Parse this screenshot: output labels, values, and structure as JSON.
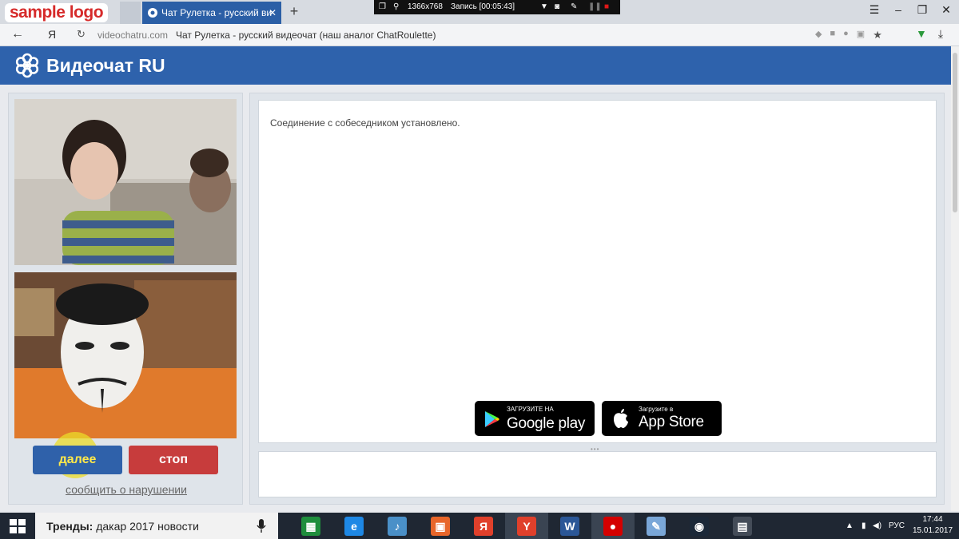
{
  "overlay_logo": "sample logo",
  "browser": {
    "tabs": [
      {
        "label": "",
        "active": false
      },
      {
        "label": "Чат Рулетка - русский ви",
        "active": true
      }
    ],
    "new_tab": "+",
    "recorder": {
      "resolution": "1366x768",
      "status": "Запись [00:05:43]"
    },
    "address": {
      "ya": "Я",
      "url": "videochatru.com",
      "title": "Чат Рулетка - русский видеочат (наш аналог ChatRoulette)"
    },
    "icons": [
      "back-arrow-icon",
      "reload-icon",
      "star-icon",
      "download-icon",
      "menu-icon"
    ]
  },
  "site": {
    "title": "Видеочат RU",
    "brand_color": "#2e62ac"
  },
  "controls": {
    "next_label": "далее",
    "stop_label": "стоп",
    "report_label": "сообщить о нарушении",
    "next_color": "#2f61aa",
    "stop_color": "#c73c3c"
  },
  "chat": {
    "status_message": "Соединение с собеседником установлено.",
    "google_play": {
      "small": "ЗАГРУЗИТЕ НА",
      "big": "Google play"
    },
    "app_store": {
      "small": "Загрузите в",
      "big": "App Store"
    }
  },
  "taskbar": {
    "search_prefix": "Тренды:",
    "search_text": "дакар 2017 новости",
    "apps": [
      {
        "name": "store-icon",
        "color": "#1f8e3d",
        "open": false
      },
      {
        "name": "internet-explorer-icon",
        "color": "#1e88e5",
        "open": false
      },
      {
        "name": "audio-player-icon",
        "color": "#4a90c8",
        "open": false
      },
      {
        "name": "photo-app-icon",
        "color": "#e8662a",
        "open": false
      },
      {
        "name": "yandex-icon",
        "color": "#e0402b",
        "open": false
      },
      {
        "name": "yandex-browser-icon",
        "color": "#e0402b",
        "open": true
      },
      {
        "name": "word-icon",
        "color": "#2b5797",
        "open": false
      },
      {
        "name": "recorder-icon",
        "color": "#d40000",
        "open": true
      },
      {
        "name": "paint-icon",
        "color": "#7aa7d8",
        "open": false
      },
      {
        "name": "steam-icon",
        "color": "#1b2838",
        "open": false
      },
      {
        "name": "video-editor-icon",
        "color": "#444c58",
        "open": false
      }
    ],
    "language": "РУС",
    "time": "17:44",
    "date": "15.01.2017"
  }
}
